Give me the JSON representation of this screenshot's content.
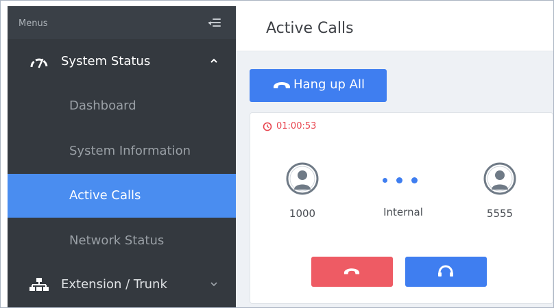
{
  "sidebar": {
    "menus_label": "Menus",
    "groups": [
      {
        "label": "System Status",
        "icon": "gauge-icon",
        "expanded": true
      },
      {
        "label": "Extension / Trunk",
        "icon": "network-icon",
        "expanded": false
      }
    ],
    "items": [
      {
        "label": "Dashboard",
        "active": false
      },
      {
        "label": "System Information",
        "active": false
      },
      {
        "label": "Active Calls",
        "active": true
      },
      {
        "label": "Network Status",
        "active": false
      }
    ]
  },
  "header": {
    "title": "Active Calls"
  },
  "toolbar": {
    "hangup_all_label": "Hang up All"
  },
  "call": {
    "duration": "01:00:53",
    "caller": "1000",
    "type": "Internal",
    "callee": "5555"
  },
  "colors": {
    "sidebar_bg": "#34393f",
    "accent": "#4a8df0",
    "button_blue": "#3f7ef0",
    "danger": "#ee5b64",
    "timer_red": "#e8454f"
  }
}
